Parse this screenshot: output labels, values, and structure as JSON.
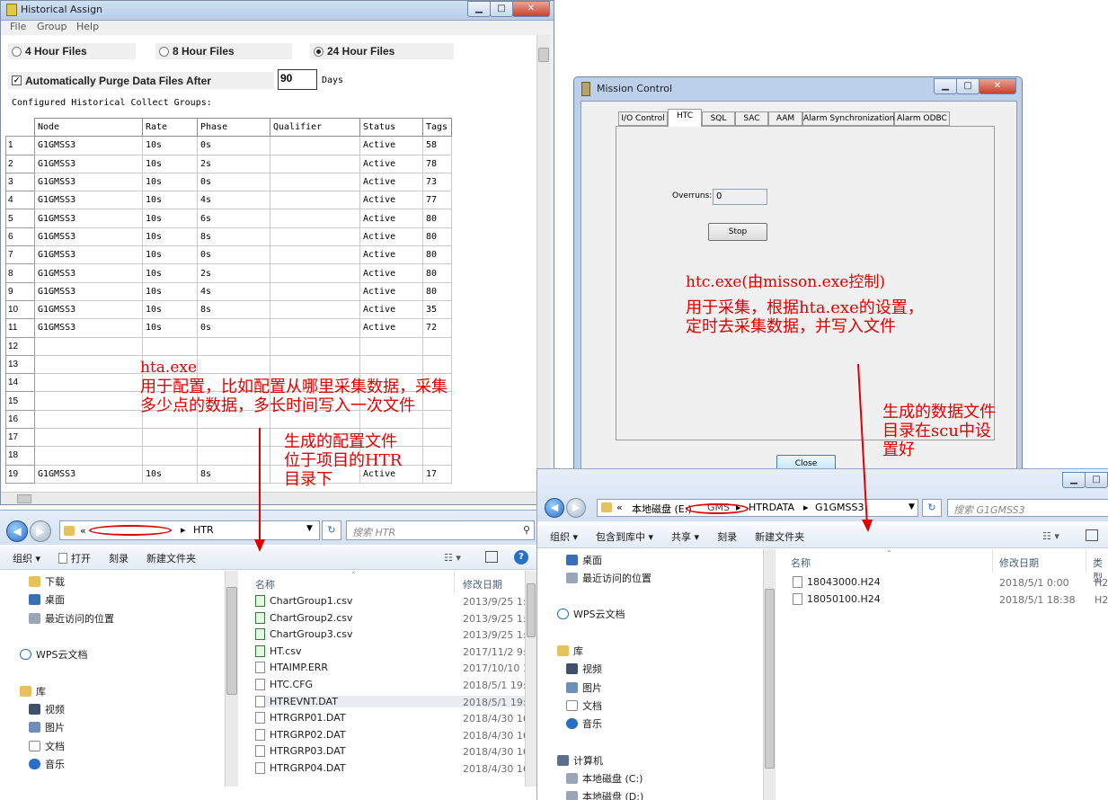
{
  "hist": {
    "title": "Historical Assign",
    "menu": [
      "File",
      "Group",
      "Help"
    ],
    "radio": [
      "4 Hour Files",
      "8 Hour Files",
      "24 Hour Files"
    ],
    "purge_label": "Automatically Purge Data Files After",
    "purge_value": "90",
    "days_label": "Days",
    "configured_label": "Configured Historical Collect Groups:",
    "columns": [
      "Node",
      "Rate",
      "Phase",
      "Qualifier",
      "Status",
      "Tags"
    ],
    "rows": [
      [
        "1",
        "G1GMSS3",
        "10s",
        "0s",
        "",
        "Active",
        "58"
      ],
      [
        "2",
        "G1GMSS3",
        "10s",
        "2s",
        "",
        "Active",
        "78"
      ],
      [
        "3",
        "G1GMSS3",
        "10s",
        "0s",
        "",
        "Active",
        "73"
      ],
      [
        "4",
        "G1GMSS3",
        "10s",
        "4s",
        "",
        "Active",
        "77"
      ],
      [
        "5",
        "G1GMSS3",
        "10s",
        "6s",
        "",
        "Active",
        "80"
      ],
      [
        "6",
        "G1GMSS3",
        "10s",
        "8s",
        "",
        "Active",
        "80"
      ],
      [
        "7",
        "G1GMSS3",
        "10s",
        "0s",
        "",
        "Active",
        "80"
      ],
      [
        "8",
        "G1GMSS3",
        "10s",
        "2s",
        "",
        "Active",
        "80"
      ],
      [
        "9",
        "G1GMSS3",
        "10s",
        "4s",
        "",
        "Active",
        "80"
      ],
      [
        "10",
        "G1GMSS3",
        "10s",
        "8s",
        "",
        "Active",
        "35"
      ],
      [
        "11",
        "G1GMSS3",
        "10s",
        "0s",
        "",
        "Active",
        "72"
      ],
      [
        "12",
        "",
        "",
        "",
        "",
        "",
        ""
      ],
      [
        "13",
        "",
        "",
        "",
        "",
        "",
        ""
      ],
      [
        "14",
        "",
        "",
        "",
        "",
        "",
        ""
      ],
      [
        "15",
        "",
        "",
        "",
        "",
        "",
        ""
      ],
      [
        "16",
        "",
        "",
        "",
        "",
        "",
        ""
      ],
      [
        "17",
        "",
        "",
        "",
        "",
        "",
        ""
      ],
      [
        "18",
        "",
        "",
        "",
        "",
        "",
        ""
      ],
      [
        "19",
        "G1GMSS3",
        "10s",
        "8s",
        "",
        "Active",
        "17"
      ]
    ]
  },
  "mission": {
    "title": "Mission Control",
    "tabs": [
      "I/O Control",
      "HTC",
      "SQL",
      "SAC",
      "AAM",
      "Alarm Synchronization",
      "Alarm ODBC"
    ],
    "overruns_label": "Overruns:",
    "overruns_value": "0",
    "stop_label": "Stop",
    "close_label": "Close"
  },
  "annotations": {
    "hta": [
      "hta.exe",
      "用于配置，比如配置从哪里采集数据，采集",
      "多少点的数据，多长时间写入一次文件"
    ],
    "config": [
      "生成的配置文件",
      "位于项目的HTR",
      "目录下"
    ],
    "htc": [
      "htc.exe(由misson.exe控制)",
      "用于采集，根据hta.exe的设置，",
      "定时去采集数据，并写入文件"
    ],
    "data": [
      "生成的数据文件",
      "目录在scu中设",
      "置好"
    ]
  },
  "explorer_left": {
    "path_prefix": "«",
    "path_last": "HTR",
    "search_placeholder": "搜索 HTR",
    "toolbar": [
      "组织 ▾",
      "打开",
      "刻录",
      "新建文件夹"
    ],
    "nav": [
      "下载",
      "桌面",
      "最近访问的位置",
      "WPS云文档",
      "库",
      "视频",
      "图片",
      "文档",
      "音乐"
    ],
    "col_name": "名称",
    "col_date": "修改日期",
    "files": [
      {
        "name": "ChartGroup1.csv",
        "date": "2013/9/25 1:0",
        "csv": true
      },
      {
        "name": "ChartGroup2.csv",
        "date": "2013/9/25 1:0",
        "csv": true
      },
      {
        "name": "ChartGroup3.csv",
        "date": "2013/9/25 1:0",
        "csv": true
      },
      {
        "name": "HT.csv",
        "date": "2017/11/2 9:4",
        "csv": true
      },
      {
        "name": "HTAIMP.ERR",
        "date": "2017/10/10 1",
        "csv": false
      },
      {
        "name": "HTC.CFG",
        "date": "2018/5/1 19:0",
        "csv": false
      },
      {
        "name": "HTREVNT.DAT",
        "date": "2018/5/1 19:0",
        "csv": false
      },
      {
        "name": "HTRGRP01.DAT",
        "date": "2018/4/30 16:",
        "csv": false
      },
      {
        "name": "HTRGRP02.DAT",
        "date": "2018/4/30 16:",
        "csv": false
      },
      {
        "name": "HTRGRP03.DAT",
        "date": "2018/4/30 16:",
        "csv": false
      },
      {
        "name": "HTRGRP04.DAT",
        "date": "2018/4/30 16:",
        "csv": false
      }
    ]
  },
  "explorer_right": {
    "path": [
      "«",
      "本地磁盘 (E:)",
      "GMS",
      "HTRDATA",
      "G1GMSS3"
    ],
    "search_placeholder": "搜索 G1GMSS3",
    "toolbar": [
      "组织 ▾",
      "包含到库中 ▾",
      "共享 ▾",
      "刻录",
      "新建文件夹"
    ],
    "nav": [
      "桌面",
      "最近访问的位置",
      "WPS云文档",
      "库",
      "视频",
      "图片",
      "文档",
      "音乐",
      "计算机",
      "本地磁盘 (C:)",
      "本地磁盘 (D:)"
    ],
    "col_name": "名称",
    "col_date": "修改日期",
    "col_type": "类型",
    "files": [
      {
        "name": "18043000.H24",
        "date": "2018/5/1 0:00",
        "type": "H2"
      },
      {
        "name": "18050100.H24",
        "date": "2018/5/1 18:38",
        "type": "H2"
      }
    ]
  }
}
